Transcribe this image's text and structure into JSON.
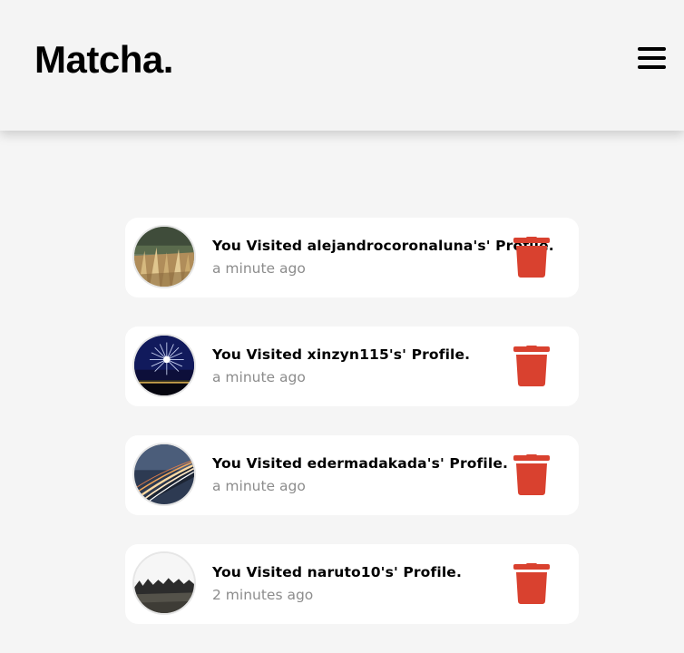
{
  "header": {
    "logo": "Matcha.",
    "menu_icon": "hamburger-menu-icon"
  },
  "colors": {
    "delete": "#d9412f",
    "timestamp": "#8c8c8c",
    "background": "#f5f5f5",
    "card": "#ffffff"
  },
  "notifications": [
    {
      "text": "You Visited alejandrocoronaluna's' Profile.",
      "time": "a minute ago",
      "avatar": "wheat-field-photo",
      "action_icon": "trash-icon"
    },
    {
      "text": "You Visited xinzyn115's' Profile.",
      "time": "a minute ago",
      "avatar": "fireworks-photo",
      "action_icon": "trash-icon"
    },
    {
      "text": "You Visited edermadakada's' Profile.",
      "time": "a minute ago",
      "avatar": "light-trails-photo",
      "action_icon": "trash-icon"
    },
    {
      "text": "You Visited naruto10's' Profile.",
      "time": "2 minutes ago",
      "avatar": "forest-landscape-photo",
      "action_icon": "trash-icon"
    }
  ]
}
